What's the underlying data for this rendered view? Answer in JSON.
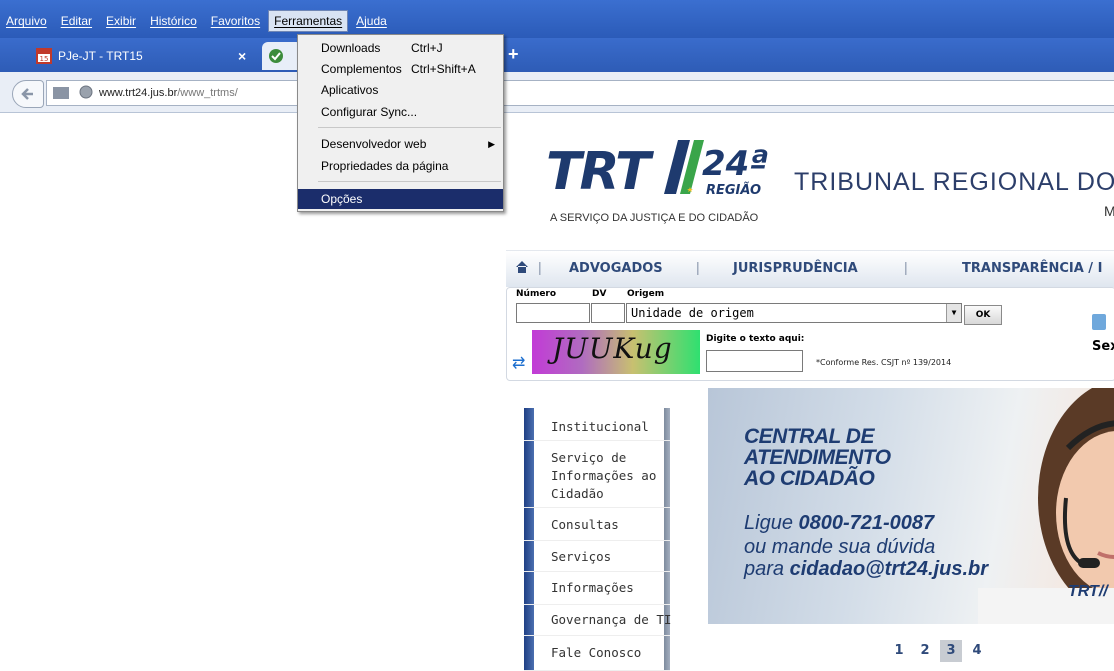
{
  "menubar": {
    "items": [
      "Arquivo",
      "Editar",
      "Exibir",
      "Histórico",
      "Favoritos",
      "Ferramentas",
      "Ajuda"
    ],
    "active": "Ferramentas"
  },
  "tabs": [
    {
      "title": "PJe-JT - TRT15",
      "icon": "trt15-favicon",
      "close": "×"
    },
    {
      "title": "",
      "icon": "site-favicon"
    }
  ],
  "newtab_label": "+",
  "address": {
    "host": "www.trt24.jus.br",
    "path": "/www_trtms/"
  },
  "tools_menu": {
    "items": [
      {
        "label": "Downloads",
        "shortcut": "Ctrl+J"
      },
      {
        "label": "Complementos",
        "shortcut": "Ctrl+Shift+A"
      },
      {
        "label": "Aplicativos",
        "shortcut": ""
      },
      {
        "label": "Configurar Sync...",
        "shortcut": ""
      },
      {
        "label": "Desenvolvedor web",
        "shortcut": "",
        "submenu": true
      },
      {
        "label": "Propriedades da página",
        "shortcut": ""
      },
      {
        "label": "Opções",
        "shortcut": "",
        "selected": true
      }
    ]
  },
  "site": {
    "logo_trt": "TRT",
    "logo_num": "24ª",
    "logo_regiao": "REGIÃO",
    "tagline": "A SERVIÇO DA JUSTIÇA E DO CIDADÃO",
    "title": "TRIBUNAL REGIONAL DO",
    "subtitle": "M",
    "nav": [
      "ADVOGADOS",
      "JURISPRUDÊNCIA",
      "TRANSPARÊNCIA / I"
    ],
    "search": {
      "numero_label": "Número",
      "dv_label": "DV",
      "origem_label": "Origem",
      "origem_value": "Unidade de origem",
      "ok_label": "OK",
      "captcha_text": "JUUKug",
      "captcha_prompt": "Digite o texto aqui:",
      "note": "*Conforme Res. CSJT nº 139/2014",
      "right_label": "Sex"
    },
    "side_menu": [
      "Institucional",
      "Serviço de Informações ao Cidadão",
      "Consultas",
      "Serviços",
      "Informações",
      "Governança de TI",
      "Fale Conosco"
    ],
    "banner": {
      "headline_1": "CENTRAL DE",
      "headline_2": "ATENDIMENTO",
      "headline_3": "AO CIDADÃO",
      "phone_prefix": "Ligue",
      "phone": "0800-721-0087",
      "line2": "ou mande sua dúvida",
      "mail_prefix": "para",
      "email": "cidadao@trt24.jus.br",
      "corner_logo": "TRT//"
    },
    "pager": [
      "1",
      "2",
      "3",
      "4"
    ],
    "pager_active": "3"
  }
}
